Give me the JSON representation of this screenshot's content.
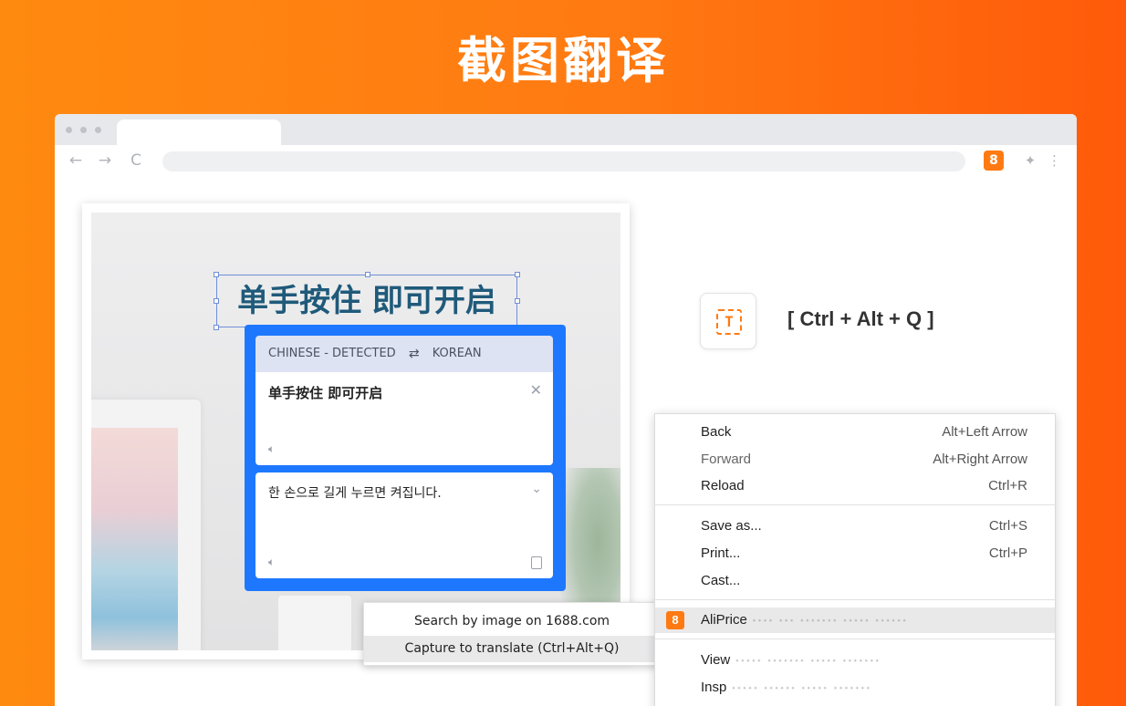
{
  "banner": {
    "title": "截图翻译"
  },
  "browser": {
    "nav": {
      "back": "←",
      "forward": "→",
      "reload": "C"
    },
    "extension_badge": "8"
  },
  "demo": {
    "selected_text": "单手按住 即可开启",
    "translate_popup": {
      "source_lang": "CHINESE - DETECTED",
      "target_lang": "KOREAN",
      "source_text": "单手按住 即可开启",
      "translated_text": "한 손으로 길게 누르면 켜집니다."
    },
    "mini_menu": {
      "items": [
        "Search by image on 1688.com",
        "Capture to translate (Ctrl+Alt+Q)"
      ]
    }
  },
  "shortcut": {
    "icon_glyph": "T",
    "label": "[ Ctrl + Alt + Q ]"
  },
  "context_menu": {
    "items": [
      {
        "label": "Back",
        "shortcut": "Alt+Left Arrow"
      },
      {
        "label": "Forward",
        "shortcut": "Alt+Right Arrow"
      },
      {
        "label": "Reload",
        "shortcut": "Ctrl+R"
      },
      {
        "label": "Save as...",
        "shortcut": "Ctrl+S"
      },
      {
        "label": "Print...",
        "shortcut": "Ctrl+P"
      },
      {
        "label": "Cast...",
        "shortcut": ""
      },
      {
        "label": "AliPrice",
        "shortcut": ""
      },
      {
        "label": "View",
        "shortcut": ""
      },
      {
        "label": "Insp",
        "shortcut": ""
      }
    ],
    "ali_badge": "8"
  },
  "colors": {
    "accent": "#ff7a12",
    "popup_blue": "#1e78ff",
    "selection_text": "#1f5a7a"
  }
}
